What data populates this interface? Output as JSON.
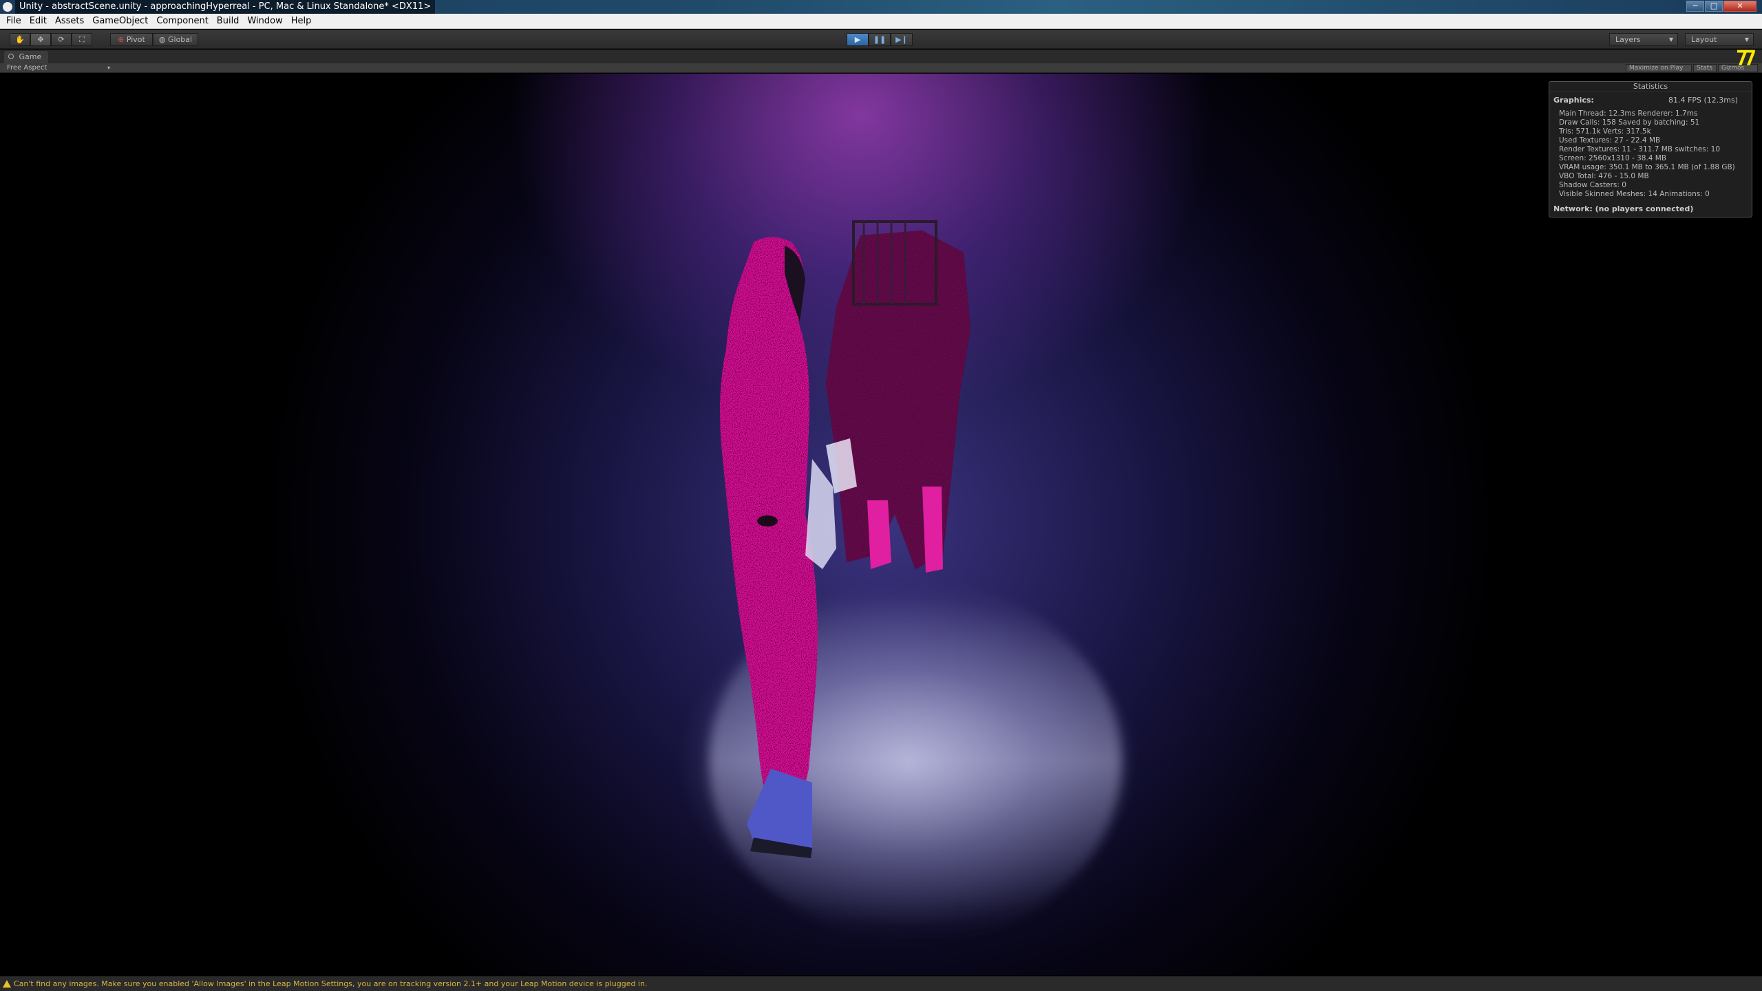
{
  "window": {
    "title": "Unity - abstractScene.unity - approachingHyperreal - PC, Mac & Linux Standalone* <DX11>",
    "minimize_label": "─",
    "maximize_label": "□",
    "close_label": "✕"
  },
  "menu": {
    "items": [
      "File",
      "Edit",
      "Assets",
      "GameObject",
      "Component",
      "Build",
      "Window",
      "Help"
    ]
  },
  "toolbar": {
    "tools": [
      {
        "name": "hand-tool",
        "icon": "✋"
      },
      {
        "name": "move-tool",
        "icon": "✥"
      },
      {
        "name": "rotate-tool",
        "icon": "⟳"
      },
      {
        "name": "scale-tool",
        "icon": "⛶"
      }
    ],
    "pivot_label": "Pivot",
    "global_label": "Global",
    "play_icon": "▶",
    "pause_icon": "❚❚",
    "step_icon": "▶❙",
    "layers_label": "Layers",
    "layout_label": "Layout"
  },
  "game_view": {
    "tab_label": "Game",
    "aspect_label": "Free Aspect",
    "maximize_label": "Maximize on Play",
    "stats_label": "Stats",
    "gizmos_label": "Gizmos",
    "fps_glyph": "77"
  },
  "statistics": {
    "title": "Statistics",
    "graphics_label": "Graphics:",
    "fps": "81.4 FPS (12.3ms)",
    "lines": [
      "Main Thread: 12.3ms  Renderer: 1.7ms",
      "Draw Calls: 158   Saved by batching: 51",
      "Tris: 571.1k     Verts: 317.5k",
      "Used Textures: 27 - 22.4 MB",
      "Render Textures: 11 - 311.7 MB    switches: 10",
      "Screen: 2560x1310 - 38.4 MB",
      "VRAM usage: 350.1 MB to 365.1 MB (of 1.88 GB)",
      "VBO Total: 476 - 15.0 MB",
      "Shadow Casters: 0",
      "Visible Skinned Meshes: 14    Animations: 0"
    ],
    "network": "Network: (no players connected)"
  },
  "status_bar": {
    "message": "Can't find any images. Make sure you enabled 'Allow Images' in the Leap Motion Settings, you are on tracking version 2.1+ and your Leap Motion device is plugged in."
  },
  "colors": {
    "figure_pink": "#e0189c",
    "fps_yellow": "#ffe800",
    "warning": "#d9b545"
  }
}
